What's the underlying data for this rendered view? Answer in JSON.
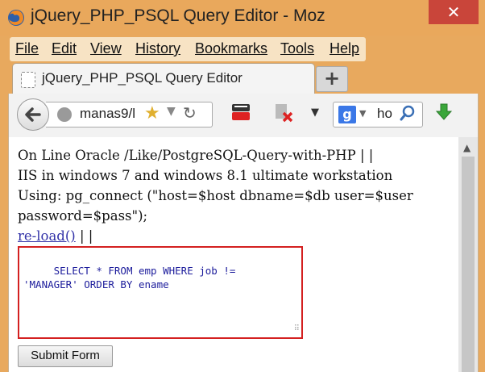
{
  "window": {
    "title": "jQuery_PHP_PSQL Query Editor - Moz",
    "close_label": "✕"
  },
  "menu": {
    "items": [
      {
        "label": "File"
      },
      {
        "label": "Edit"
      },
      {
        "label": "View"
      },
      {
        "label": "History"
      },
      {
        "label": "Bookmarks"
      },
      {
        "label": "Tools"
      },
      {
        "label": "Help"
      }
    ]
  },
  "tab": {
    "label": "jQuery_PHP_PSQL Query Editor",
    "new_tab_label": "+"
  },
  "navbar": {
    "url": "manas9/l",
    "search_value": "ho",
    "search_engine": "g",
    "icons": [
      "back-arrow",
      "globe",
      "star",
      "reload",
      "youtube",
      "block",
      "dropdown",
      "google",
      "search",
      "download"
    ]
  },
  "page": {
    "line1": "On Line Oracle /Like/PostgreSQL-Query-with-PHP | |",
    "line2": "IIS in windows 7 and windows 8.1 ultimate workstation",
    "line3": "Using: pg_connect (\"host=$host dbname=$db user=$user",
    "line4": "password=$pass\");",
    "reload_link": "re-load()",
    "after_link": " | |",
    "query": " SELECT * FROM emp WHERE job !=\n'MANAGER' ORDER BY ename",
    "submit_label": "Submit Form"
  },
  "colors": {
    "titlebar": "#e9a85c",
    "close_button": "#c9453a",
    "query_border": "#d42020",
    "link": "#3232a8"
  }
}
